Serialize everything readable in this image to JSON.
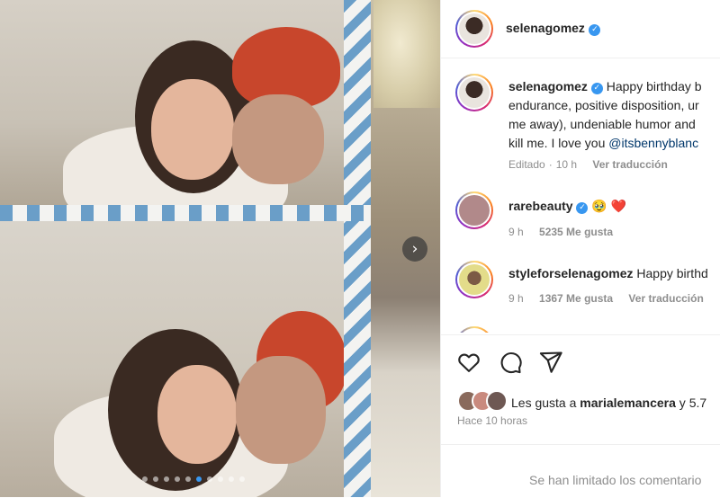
{
  "post": {
    "author": "selenagomez",
    "verified": true,
    "carousel": {
      "total_slides": 10,
      "active_slide": 6
    }
  },
  "caption": {
    "username": "selenagomez",
    "lines": [
      "Happy birthday b",
      "endurance, positive disposition, ur",
      "me away), undeniable humor and",
      "kill me. I love you "
    ],
    "mention": "@itsbennyblanc",
    "meta": {
      "status": "Editado",
      "separator": "·",
      "time": "10 h",
      "translate": "Ver traducción"
    }
  },
  "comments": [
    {
      "username": "rarebeauty",
      "verified": true,
      "text": "",
      "emoji": [
        "🥹",
        "❤️"
      ],
      "time": "9 h",
      "likes": "5235 Me gusta",
      "translate": ""
    },
    {
      "username": "styleforselenagomez",
      "verified": false,
      "text": "Happy birthd",
      "emoji": [],
      "time": "9 h",
      "likes": "1367 Me gusta",
      "translate": "Ver traducción"
    }
  ],
  "actions": {
    "icons": [
      "heart-icon",
      "comment-icon",
      "share-icon"
    ]
  },
  "likes": {
    "prefix": "Les gusta a ",
    "user": "marialemancera",
    "suffix": " y 5.7"
  },
  "timestamp": "Hace 10 horas",
  "comments_limited": "Se han limitado los comentario",
  "colors": {
    "link": "#00376b",
    "verified": "#3897f0",
    "muted": "#8e8e8e",
    "heart": "#ed4956"
  }
}
